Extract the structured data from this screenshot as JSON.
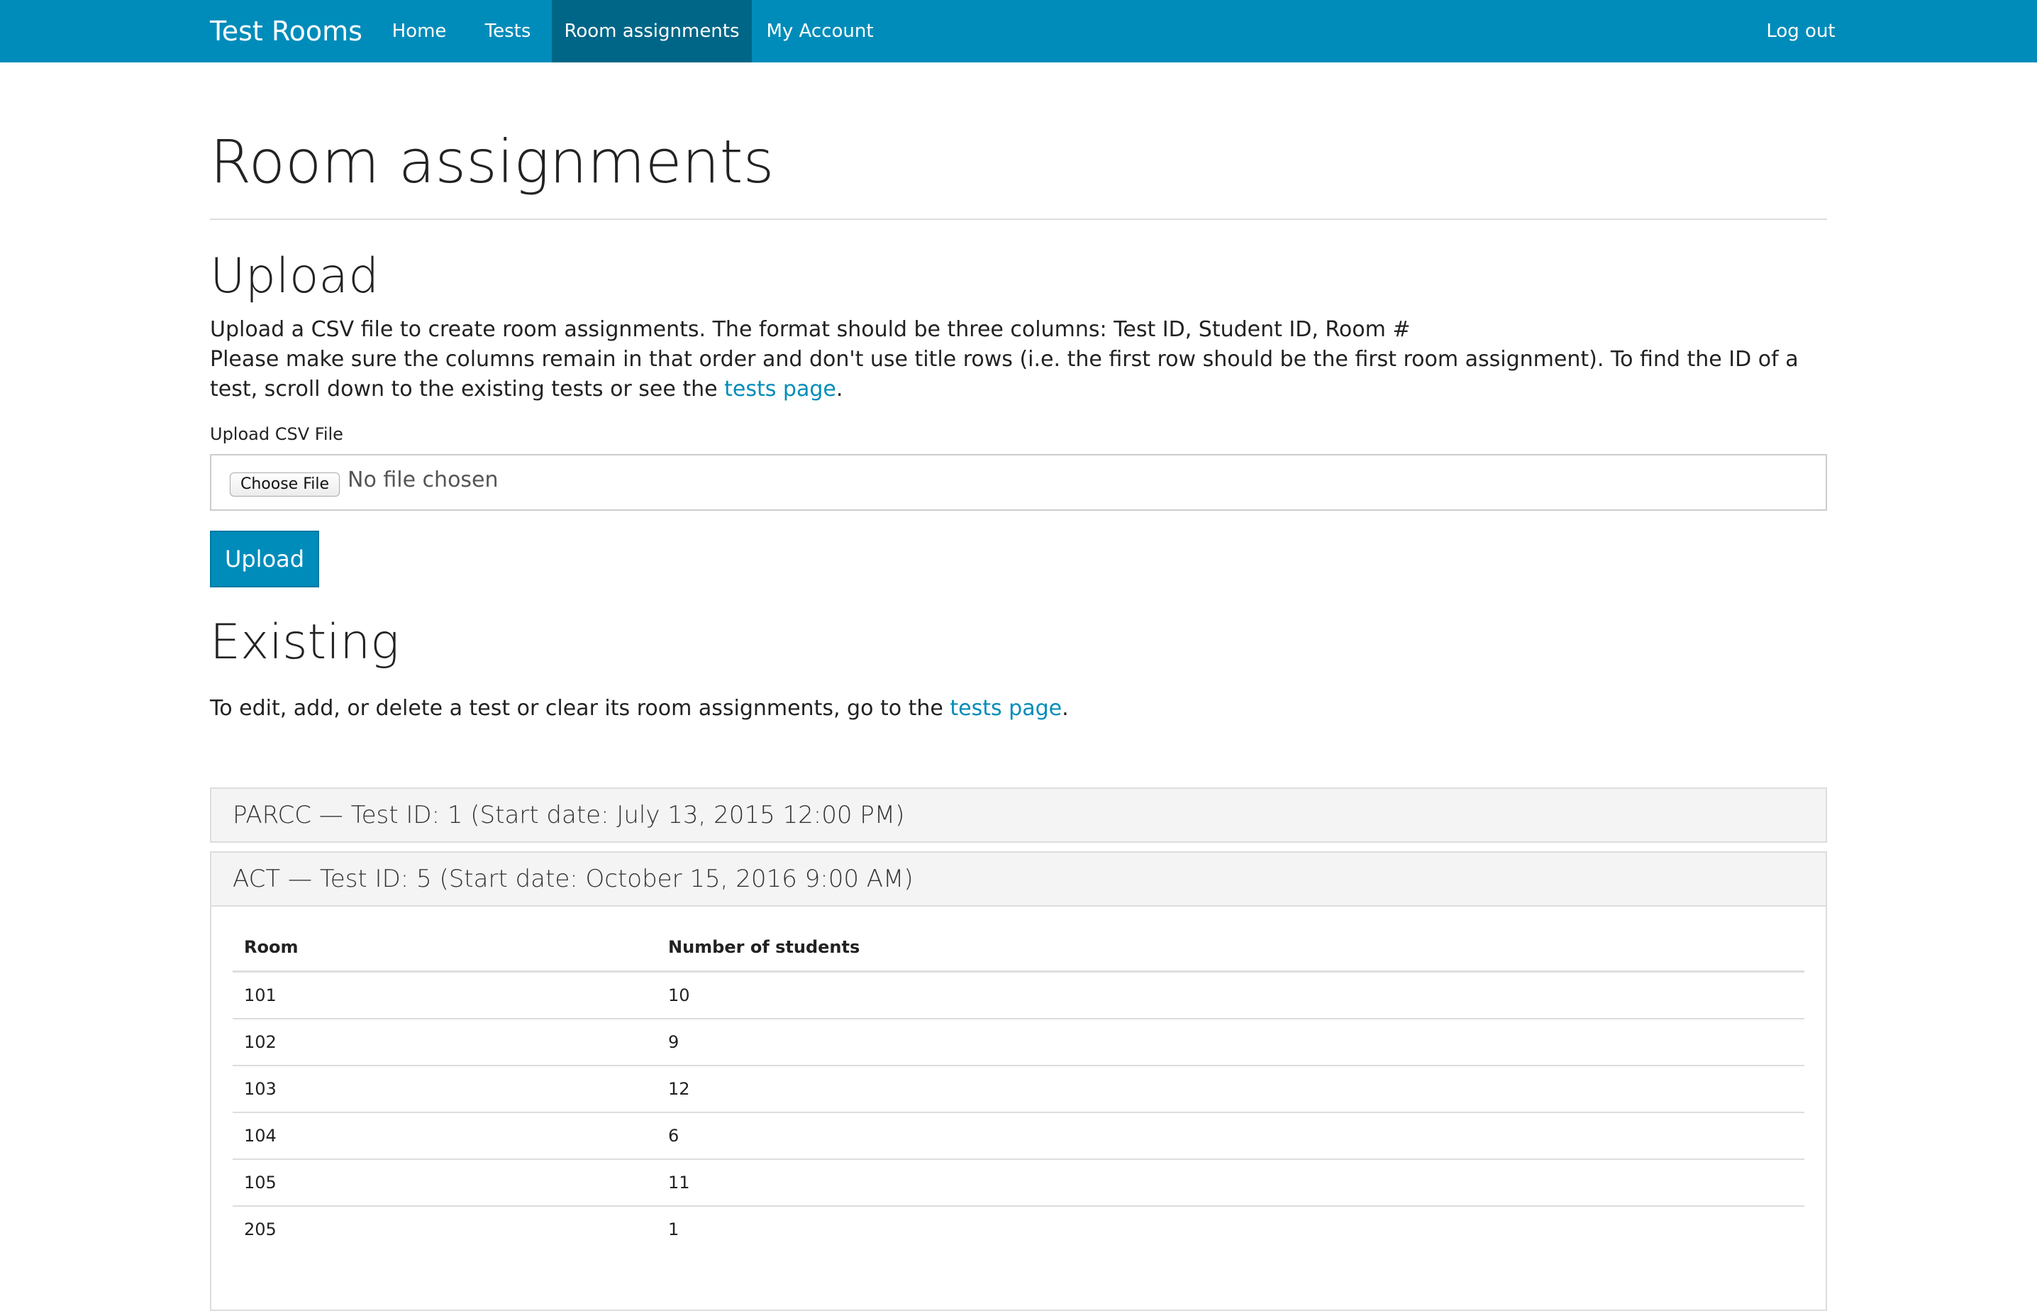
{
  "navbar": {
    "brand": "Test Rooms",
    "items": [
      {
        "label": "Home"
      },
      {
        "label": "Tests"
      },
      {
        "label": "Room assignments",
        "active": true
      },
      {
        "label": "My Account"
      }
    ],
    "logout": "Log out",
    "colors": {
      "background": "#008cba",
      "active": "#006687"
    }
  },
  "page": {
    "title": "Room assignments"
  },
  "upload": {
    "heading": "Upload",
    "line1": "Upload a CSV file to create room assignments. The format should be three columns: Test ID, Student ID, Room #",
    "line2_before": "Please make sure the columns remain in that order and don't use title rows (i.e. the first row should be the first room assignment). To find the ID of a test, scroll down to the existing tests or see the ",
    "link": "tests page",
    "line2_after": ".",
    "field_label": "Upload CSV File",
    "choose_button": "Choose File",
    "no_file": "No file chosen",
    "submit": "Upload"
  },
  "existing": {
    "heading": "Existing",
    "desc_before": "To edit, add, or delete a test or clear its room assignments, go to the ",
    "link": "tests page",
    "desc_after": ".",
    "tests": [
      {
        "header": "PARCC — Test ID: 1 (Start date: July 13, 2015 12:00 PM)",
        "expanded": false
      },
      {
        "header": "ACT — Test ID: 5 (Start date: October 15, 2016 9:00 AM)",
        "expanded": true,
        "table": {
          "columns": [
            "Room",
            "Number of students"
          ],
          "rows": [
            [
              "101",
              "10"
            ],
            [
              "102",
              "9"
            ],
            [
              "103",
              "12"
            ],
            [
              "104",
              "6"
            ],
            [
              "105",
              "11"
            ],
            [
              "205",
              "1"
            ]
          ]
        }
      }
    ]
  },
  "colors": {
    "accent": "#008cba",
    "text": "#222222",
    "border": "#dddddd",
    "panel_header_bg": "#f4f4f4"
  }
}
